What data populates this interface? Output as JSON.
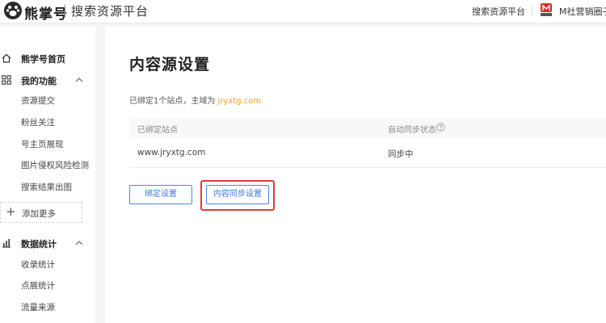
{
  "header": {
    "brand": "熊掌号",
    "subtitle": "搜索资源平台",
    "nav_link": "搜索资源平台",
    "user_name": "M社营销圈子"
  },
  "sidebar": {
    "home": "熊学号首页",
    "groups": [
      {
        "label": "我的功能",
        "items": [
          "资源提交",
          "粉丝关注",
          "号主页展现",
          "图片侵权风险检测",
          "搜索结果出图"
        ]
      },
      {
        "label": "数据统计",
        "items": [
          "收录统计",
          "点展统计",
          "流量来源"
        ]
      }
    ],
    "add_more": "添加更多"
  },
  "main": {
    "title": "内容源设置",
    "bind_prefix": "已绑定1个站点，主域为 ",
    "bind_domain": "jryxtg.com",
    "table": {
      "headers": [
        "已绑定站点",
        "自动同步状态"
      ],
      "rows": [
        {
          "site": "www.jryxtg.com",
          "status": "同步中"
        }
      ]
    },
    "buttons": {
      "bind": "绑定设置",
      "sync": "内容同步设置"
    }
  },
  "colors": {
    "accent": "#3a78e0",
    "domain": "#f0a020",
    "highlight": "#e53935"
  },
  "icons": {
    "logo": "paw-icon",
    "home": "home-icon",
    "functions": "grid-icon",
    "stats": "bar-chart-icon",
    "add": "plus-icon",
    "help": "help-circle-icon"
  }
}
